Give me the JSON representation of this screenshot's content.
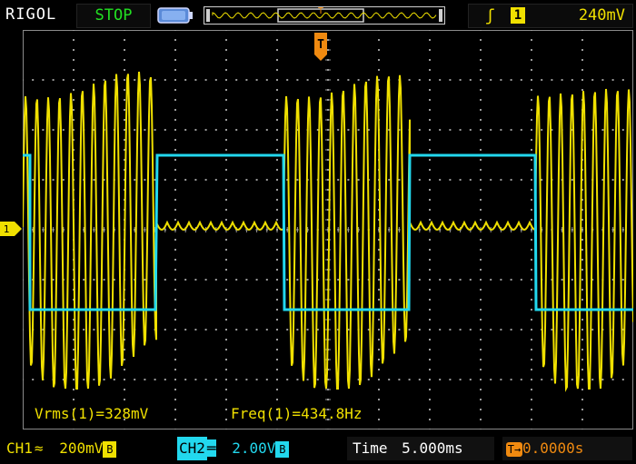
{
  "header": {
    "brand": "RIGOL",
    "run_status": "STOP",
    "trigger": {
      "edge_icon": "rising-edge-icon",
      "channel": "1",
      "level": "240mV"
    },
    "trigger_marker": "T"
  },
  "measurements": {
    "vrms": "Vrms(1)=328mV",
    "freq": "Freq(1)=434.8Hz"
  },
  "footer": {
    "ch1": {
      "label": "CH1",
      "coupling": "≈",
      "scale": "200mV",
      "bw": "B"
    },
    "ch2": {
      "label": "CH2",
      "coupling": "═",
      "scale": "2.00V",
      "bw": "B"
    },
    "timebase": {
      "label": "Time",
      "value": "5.000ms"
    },
    "trigger_offset": {
      "icon": "T→",
      "value": "0.0000s"
    }
  },
  "colors": {
    "ch1": "#f0e000",
    "ch2": "#22d8ee",
    "trigger": "#f08a10",
    "grid": "#9a9a9a",
    "status_stop": "#22e022"
  }
}
